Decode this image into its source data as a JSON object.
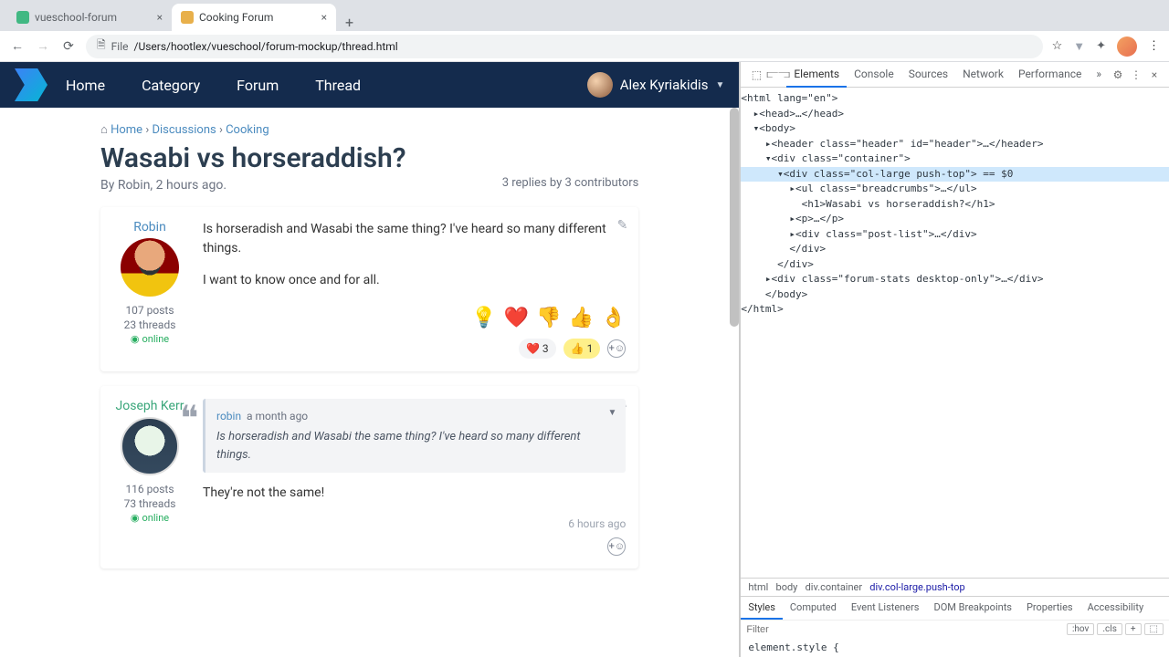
{
  "browser": {
    "tabs": [
      {
        "title": "vueschool-forum",
        "active": false
      },
      {
        "title": "Cooking Forum",
        "active": true
      }
    ],
    "toolbar": {
      "file_label": "File",
      "address": "/Users/hootlex/vueschool/forum-mockup/thread.html"
    }
  },
  "site": {
    "nav": {
      "home": "Home",
      "category": "Category",
      "forum": "Forum",
      "thread": "Thread"
    },
    "user": {
      "name": "Alex Kyriakidis"
    }
  },
  "thread": {
    "breadcrumbs": {
      "home_icon": "⌂",
      "home": "Home",
      "s1": "›",
      "discussions": "Discussions",
      "s2": "›",
      "cooking": "Cooking"
    },
    "title": "Wasabi vs horseraddish?",
    "byline": "By Robin, 2 hours ago.",
    "stats": "3 replies by 3 contributors",
    "posts": [
      {
        "author": "Robin",
        "posts_stat": "107 posts",
        "threads_stat": "23 threads",
        "online": "online",
        "p1": "Is horseradish and Wasabi the same thing? I've heard so many different things.",
        "p2": "I want to know once and for all.",
        "reactions_big": [
          "💡",
          "❤️",
          "👎",
          "👍",
          "👌"
        ],
        "reactions_sum": [
          {
            "e": "❤️",
            "n": "3"
          },
          {
            "e": "👍",
            "n": "1"
          }
        ]
      },
      {
        "author": "Joseph Kerr",
        "posts_stat": "116 posts",
        "threads_stat": "73 threads",
        "online": "online",
        "quote": {
          "author": "robin",
          "time": "a month ago",
          "body": "Is horseradish and Wasabi the same thing? I've heard so many different things."
        },
        "p1": "They're not the same!",
        "time": "6 hours ago"
      }
    ]
  },
  "devtools": {
    "tabs": [
      "Elements",
      "Console",
      "Sources",
      "Network",
      "Performance"
    ],
    "more": "»",
    "dom": {
      "l0": "<html lang=\"en\">",
      "l1": "  ▸<head>…</head>",
      "l2": "  ▾<body>",
      "l3": "    ▸<header class=\"header\" id=\"header\">…</header>",
      "l4": "    ▾<div class=\"container\">",
      "l5": "      ▾<div class=\"col-large push-top\"> == $0",
      "l6": "        ▸<ul class=\"breadcrumbs\">…</ul>",
      "l7": "          <h1>Wasabi vs horseraddish?</h1>",
      "l8": "        ▸<p>…</p>",
      "l9": "        ▸<div class=\"post-list\">…</div>",
      "l10": "        </div>",
      "l11": "      </div>",
      "l12": "    ▸<div class=\"forum-stats desktop-only\">…</div>",
      "l13": "    </body>",
      "l14": "</html>"
    },
    "breadcrumb_path": {
      "p0": "html",
      "p1": "body",
      "p2": "div.container",
      "p3": "div.col-large.push-top"
    },
    "sub_tabs": [
      "Styles",
      "Computed",
      "Event Listeners",
      "DOM Breakpoints",
      "Properties",
      "Accessibility"
    ],
    "filter_placeholder": "Filter",
    "hov": ":hov",
    "cls": ".cls",
    "style_line": "element.style {"
  }
}
